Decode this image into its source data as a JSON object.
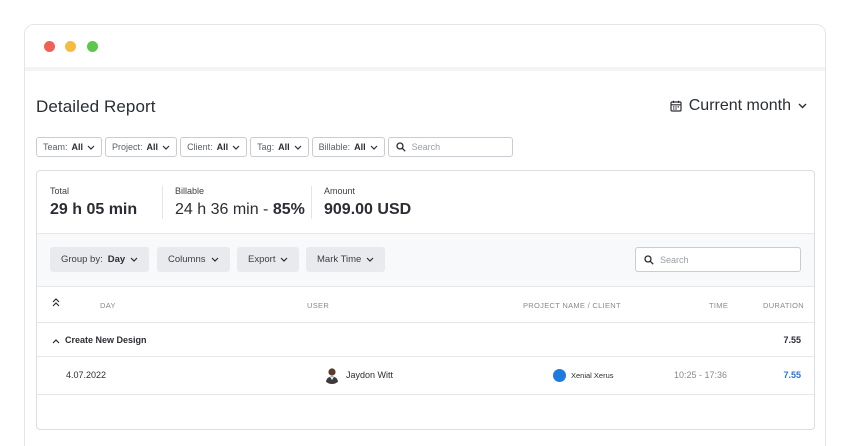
{
  "window": {
    "controls": [
      "close",
      "minimize",
      "zoom"
    ]
  },
  "header": {
    "title": "Detailed Report",
    "period_label": "Current month",
    "period_icon": "calendar-icon"
  },
  "filters": [
    {
      "label": "Team:",
      "value": "All"
    },
    {
      "label": "Project:",
      "value": "All"
    },
    {
      "label": "Client:",
      "value": "All"
    },
    {
      "label": "Tag:",
      "value": "All"
    },
    {
      "label": "Billable:",
      "value": "All"
    }
  ],
  "filter_search": {
    "placeholder": "Search"
  },
  "summary": {
    "total_label": "Total",
    "total_value": "29 h 05 min",
    "billable_label": "Billable",
    "billable_value": "24 h 36 min - ",
    "billable_percent": "85%",
    "amount_label": "Amount",
    "amount_value": "909.00 USD"
  },
  "toolbar": {
    "group_by_label": "Group by:",
    "group_by_value": "Day",
    "columns_label": "Columns",
    "export_label": "Export",
    "mark_time_label": "Mark Time",
    "search_placeholder": "Search"
  },
  "table": {
    "columns": {
      "day": "DAY",
      "user": "USER",
      "project": "PROJECT NAME / CLIENT",
      "time": "TIME",
      "duration": "DURATION"
    },
    "group": {
      "title": "Create New Design",
      "duration": "7.55"
    },
    "rows": [
      {
        "day": "4.07.2022",
        "user": "Jaydon Witt",
        "project": "Xenial Xerus",
        "time": "10:25 - 17:36",
        "duration": "7.55"
      }
    ]
  },
  "colors": {
    "accent": "#1f7ae0",
    "duration_link": "#2a6fdb",
    "close": "#ef6157",
    "minimize": "#f5bc41",
    "zoom": "#5cc84b"
  }
}
